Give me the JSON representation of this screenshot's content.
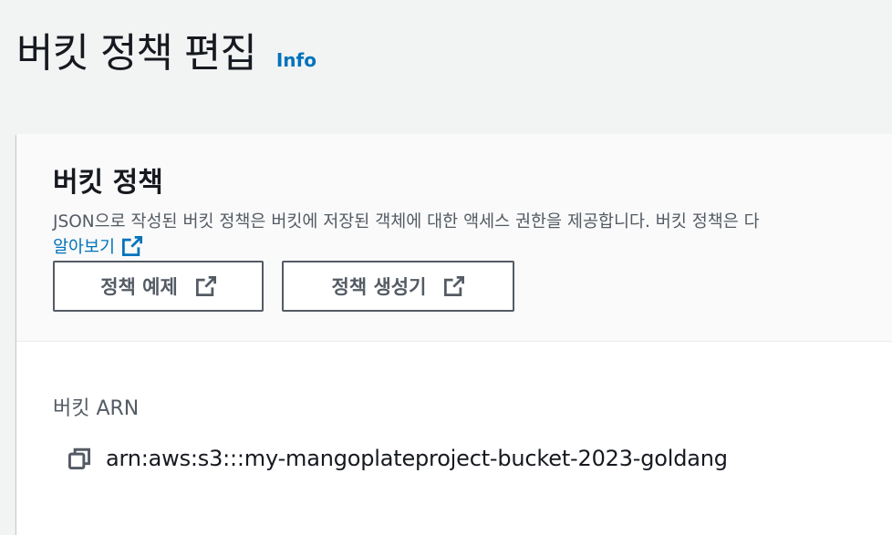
{
  "header": {
    "title": "버킷 정책 편집",
    "info_label": "Info"
  },
  "policy_section": {
    "title": "버킷 정책",
    "description": "JSON으로 작성된 버킷 정책은 버킷에 저장된 객체에 대한 액세스 권한을 제공합니다. 버킷 정책은 다",
    "learn_more_label": "알아보기",
    "buttons": {
      "policy_examples_label": "정책 예제",
      "policy_generator_label": "정책 생성기"
    }
  },
  "arn": {
    "label": "버킷 ARN",
    "value": "arn:aws:s3:::my-mangoplateproject-bucket-2023-goldang"
  },
  "icons": {
    "external_link": "external-link-icon",
    "copy": "copy-icon"
  },
  "colors": {
    "link": "#0073bb",
    "text": "#16191f",
    "secondary_text": "#545b64",
    "background": "#f2f3f3",
    "header_background": "#fafafa"
  }
}
